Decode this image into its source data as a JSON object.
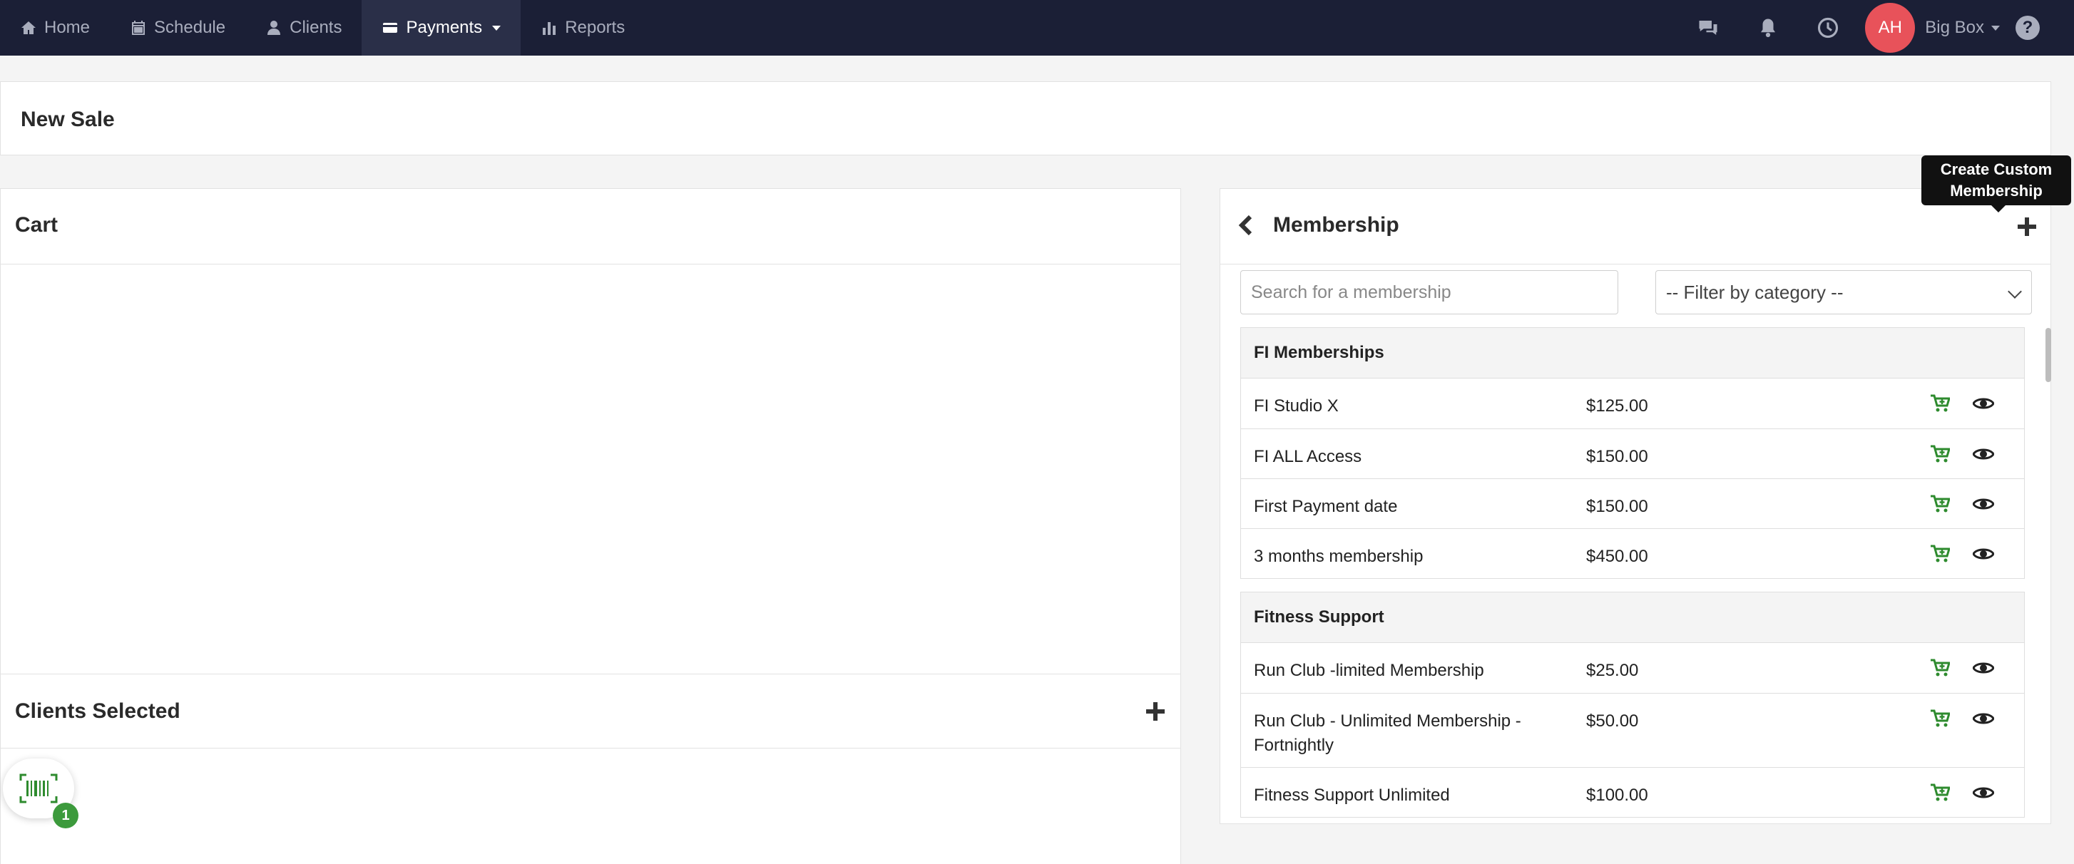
{
  "nav": {
    "items": [
      {
        "label": "Home",
        "icon": "home-icon"
      },
      {
        "label": "Schedule",
        "icon": "calendar-icon"
      },
      {
        "label": "Clients",
        "icon": "user-icon"
      },
      {
        "label": "Payments",
        "icon": "card-icon",
        "active": true
      },
      {
        "label": "Reports",
        "icon": "bar-chart-icon"
      }
    ],
    "avatar_initials": "AH",
    "org_name": "Big Box",
    "help_label": "?"
  },
  "page": {
    "title": "New Sale"
  },
  "cart": {
    "title": "Cart"
  },
  "clients": {
    "title": "Clients Selected",
    "badge_count": "1"
  },
  "membership": {
    "title": "Membership",
    "search_placeholder": "Search for a membership",
    "filter_selected": "-- Filter by category --",
    "tooltip": "Create Custom Membership",
    "categories": [
      {
        "name": "FI Memberships",
        "items": [
          {
            "name": "FI Studio X",
            "price": "$125.00"
          },
          {
            "name": "FI ALL Access",
            "price": "$150.00"
          },
          {
            "name": "First Payment date",
            "price": "$150.00"
          },
          {
            "name": "3 months membership",
            "price": "$450.00"
          }
        ]
      },
      {
        "name": "Fitness Support",
        "items": [
          {
            "name": "Run Club -limited Membership",
            "price": "$25.00"
          },
          {
            "name": "Run Club - Unlimited Membership - Fortnightly",
            "price": "$50.00"
          },
          {
            "name": "Fitness Support Unlimited",
            "price": "$100.00"
          }
        ]
      }
    ]
  },
  "colors": {
    "nav_bg": "#1b1f36",
    "nav_active_bg": "#2a2f48",
    "avatar": "#e8525a",
    "cart_icon_green": "#2e8b2e",
    "badge_green": "#3c9a3c"
  }
}
